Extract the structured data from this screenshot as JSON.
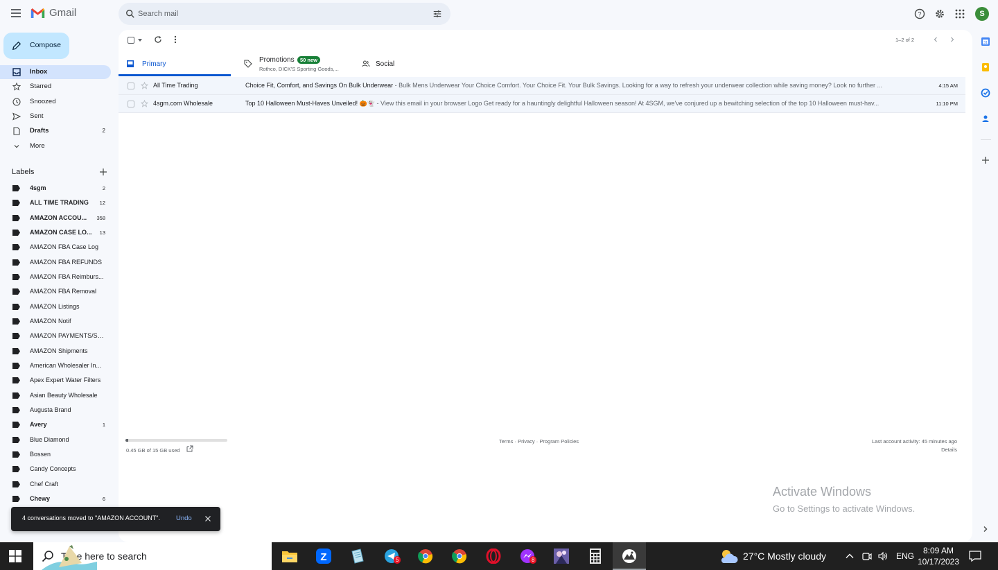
{
  "app": {
    "name": "Gmail"
  },
  "search": {
    "placeholder": "Search mail"
  },
  "header": {
    "avatar_letter": "S"
  },
  "nav": {
    "compose_label": "Compose",
    "items": [
      {
        "label": "Inbox",
        "count": "",
        "icon": "inbox-icon",
        "active": true
      },
      {
        "label": "Starred",
        "count": "",
        "icon": "star-icon"
      },
      {
        "label": "Snoozed",
        "count": "",
        "icon": "clock-icon"
      },
      {
        "label": "Sent",
        "count": "",
        "icon": "send-icon"
      },
      {
        "label": "Drafts",
        "count": "2",
        "icon": "draft-icon"
      },
      {
        "label": "More",
        "count": "",
        "icon": "chevron-down-icon"
      }
    ]
  },
  "labels": {
    "heading": "Labels",
    "items": [
      {
        "label": "4sgm",
        "count": "2",
        "bold": true
      },
      {
        "label": "ALL TIME TRADING",
        "count": "12",
        "bold": true
      },
      {
        "label": "AMAZON ACCOU...",
        "count": "358",
        "bold": true
      },
      {
        "label": "AMAZON CASE LO...",
        "count": "13",
        "bold": true
      },
      {
        "label": "AMAZON FBA Case Log",
        "count": ""
      },
      {
        "label": "AMAZON FBA REFUNDS",
        "count": ""
      },
      {
        "label": "AMAZON FBA Reimburs...",
        "count": ""
      },
      {
        "label": "AMAZON FBA Removal",
        "count": ""
      },
      {
        "label": "AMAZON Listings",
        "count": ""
      },
      {
        "label": "AMAZON Notif",
        "count": ""
      },
      {
        "label": "AMAZON PAYMENTS/SE...",
        "count": ""
      },
      {
        "label": "AMAZON Shipments",
        "count": ""
      },
      {
        "label": "American Wholesaler In...",
        "count": ""
      },
      {
        "label": "Apex Expert Water Filters",
        "count": ""
      },
      {
        "label": "Asian Beauty Wholesale",
        "count": ""
      },
      {
        "label": "Augusta Brand",
        "count": ""
      },
      {
        "label": "Avery",
        "count": "1",
        "bold": true
      },
      {
        "label": "Blue Diamond",
        "count": ""
      },
      {
        "label": "Bossen",
        "count": ""
      },
      {
        "label": "Candy Concepts",
        "count": ""
      },
      {
        "label": "Chef Craft",
        "count": ""
      },
      {
        "label": "Chewy",
        "count": "6",
        "bold": true
      }
    ]
  },
  "toolbar": {
    "pager_text": "1–2 of 2"
  },
  "tabs": {
    "primary": "Primary",
    "promotions": "Promotions",
    "promotions_badge": "50 new",
    "promotions_sub": "Rothco, DICK'S Sporting Goods,...",
    "social": "Social"
  },
  "emails": [
    {
      "sender": "All Time Trading",
      "subject": "Choice Fit, Comfort, and Savings On Bulk Underwear",
      "snippet": " - Bulk Mens Underwear Your Choice Comfort. Your Choice Fit. Your Bulk Savings. Looking for a way to refresh your underwear collection while saving money? Look no further ...",
      "time": "4:15 AM"
    },
    {
      "sender": "4sgm.com Wholesale",
      "subject": "Top 10 Halloween Must-Haves Unveiled! 🎃👻",
      "snippet": " - View this email in your browser Logo Get ready for a hauntingly delightful Halloween season! At 4SGM, we've conjured up a bewitching selection of the top 10 Halloween must-hav...",
      "time": "11:10 PM"
    }
  ],
  "footer": {
    "storage_text": "0.45 GB of 15 GB used",
    "storage_fraction": 0.03,
    "terms": "Terms",
    "privacy": "Privacy",
    "policies": "Program Policies",
    "sep": " · ",
    "last_activity": "Last account activity: 45 minutes ago",
    "details": "Details"
  },
  "watermark": {
    "line1": "Activate Windows",
    "line2": "Go to Settings to activate Windows."
  },
  "snackbar": {
    "text": "4 conversations moved to \"AMAZON ACCOUNT\".",
    "undo": "Undo"
  },
  "taskbar": {
    "search_placeholder": "Type here to search",
    "weather": "27°C  Mostly cloudy",
    "lang": "ENG",
    "time": "8:09 AM",
    "date": "10/17/2023",
    "badges": {
      "telegram": "5",
      "messenger": "8"
    }
  },
  "colors": {
    "accent": "#0b57d0",
    "compose_bg": "#c2e7ff",
    "badge_green": "#188038"
  }
}
